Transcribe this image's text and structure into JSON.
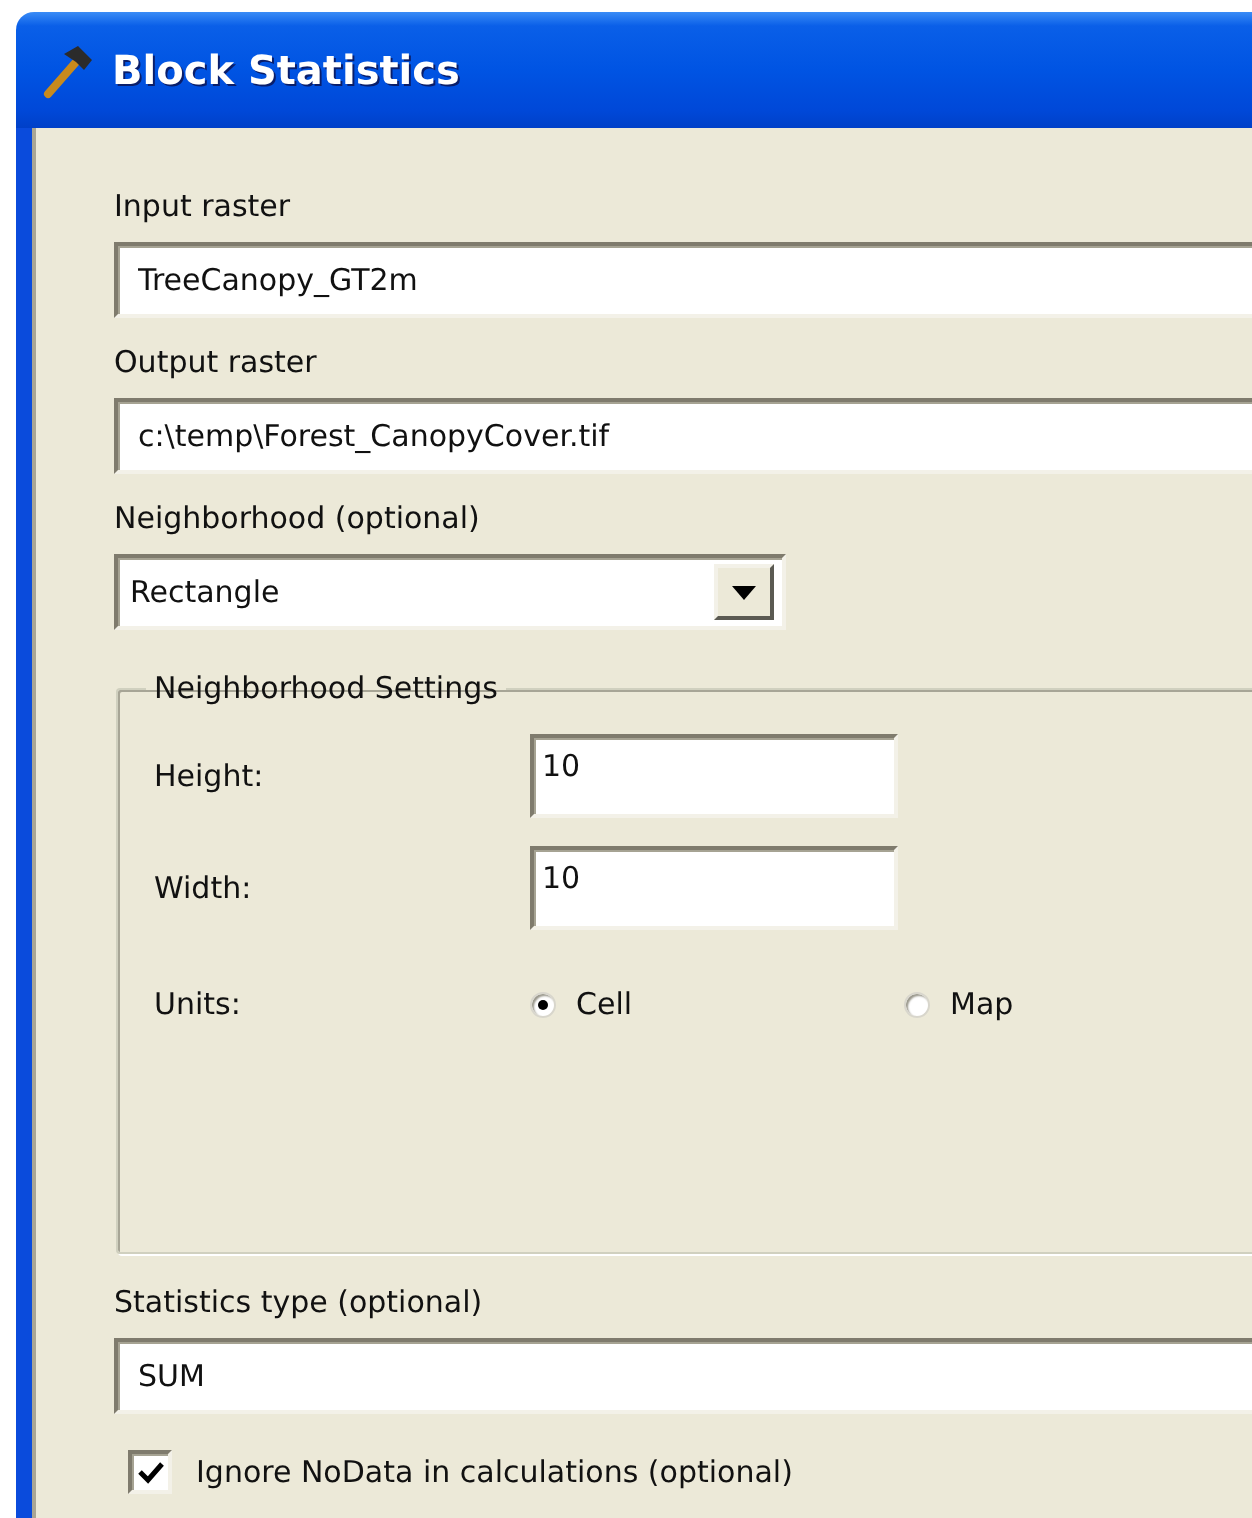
{
  "window": {
    "title": "Block Statistics"
  },
  "fields": [
    {
      "kind": "text",
      "label": "Input raster",
      "value": "TreeCanopy_GT2m"
    },
    {
      "kind": "text",
      "label": "Output raster",
      "value": "c:\\temp\\Forest_CanopyCover.tif"
    },
    {
      "kind": "dropdown",
      "label": "Neighborhood (optional)",
      "value": "Rectangle"
    }
  ],
  "neighborhood_settings": {
    "title": "Neighborhood Settings",
    "rows": [
      {
        "label": "Height:",
        "value": "10"
      },
      {
        "label": "Width:",
        "value": "10"
      }
    ],
    "units": {
      "label": "Units:",
      "options": [
        {
          "label": "Cell",
          "selected": true
        },
        {
          "label": "Map",
          "selected": false
        }
      ]
    }
  },
  "statistics_type": {
    "label": "Statistics type (optional)",
    "value": "SUM"
  },
  "ignore_nodata": {
    "label": "Ignore NoData in calculations (optional)",
    "checked": true
  }
}
